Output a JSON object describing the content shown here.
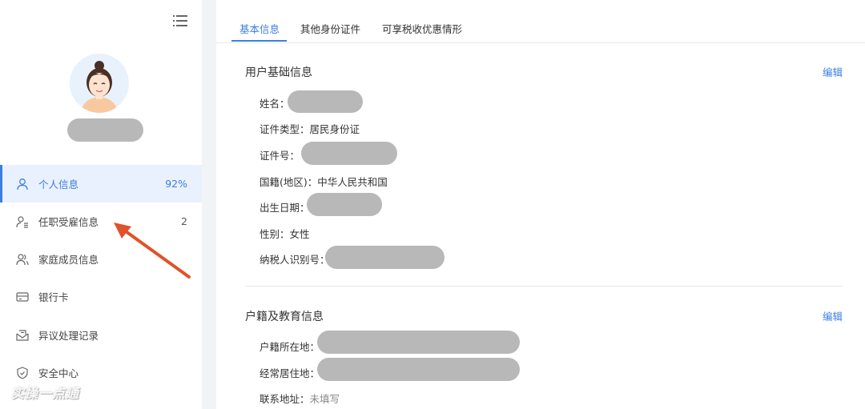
{
  "sidebar": {
    "menu_icon": "hamburger-menu-icon",
    "avatar_icon": "female-avatar-illustration",
    "items": [
      {
        "label": "个人信息",
        "extra": "92%",
        "icon": "person-icon",
        "active": true
      },
      {
        "label": "任职受雇信息",
        "extra": "2",
        "icon": "person-list-icon",
        "active": false
      },
      {
        "label": "家庭成员信息",
        "extra": "",
        "icon": "family-icon",
        "active": false
      },
      {
        "label": "银行卡",
        "extra": "",
        "icon": "card-icon",
        "active": false
      },
      {
        "label": "异议处理记录",
        "extra": "",
        "icon": "mail-record-icon",
        "active": false
      },
      {
        "label": "安全中心",
        "extra": "",
        "icon": "shield-icon",
        "active": false
      }
    ],
    "watermark": "实操一点通"
  },
  "tabs": [
    {
      "label": "基本信息",
      "active": true
    },
    {
      "label": "其他身份证件",
      "active": false
    },
    {
      "label": "可享税收优惠情形",
      "active": false
    }
  ],
  "basic": {
    "title": "用户基础信息",
    "edit_label": "编辑",
    "fields": {
      "name": "姓名：",
      "id_type": "证件类型：居民身份证",
      "id_number": "证件号：",
      "nationality": "国籍(地区)：中华人民共和国",
      "birth_date": "出生日期：",
      "gender": "性别：女性",
      "taxpayer_id": "纳税人识别号："
    }
  },
  "residence": {
    "title": "户籍及教育信息",
    "edit_label": "编辑",
    "fields": {
      "household_label": "户籍所在地：",
      "residence_label": "经常居住地：",
      "contact_label": "联系地址：",
      "contact_value": "未填写"
    }
  },
  "colors": {
    "accent": "#3b7fe0",
    "active_bg": "#e8f1fd",
    "redaction": "#b8b8b8",
    "arrow": "#e0522a"
  },
  "annotation": {
    "arrow_icon": "red-arrow-pointer-icon"
  }
}
